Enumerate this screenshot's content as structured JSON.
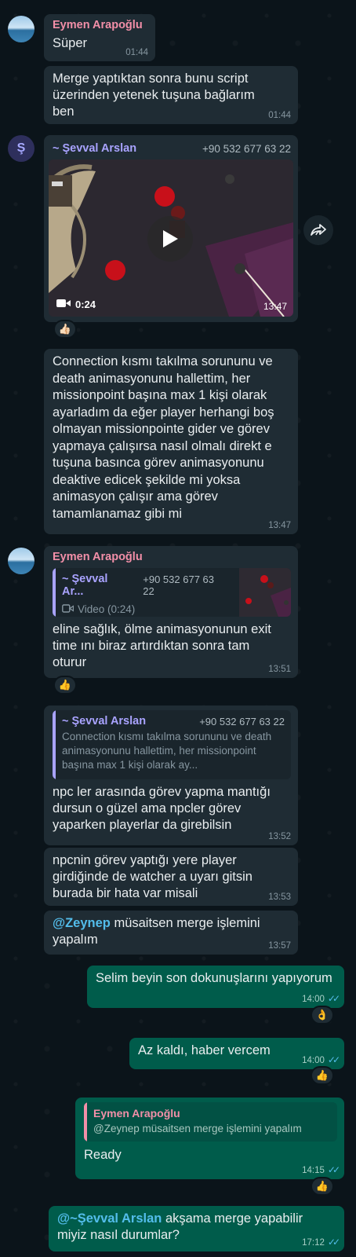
{
  "messages": {
    "m1": {
      "sender": "Eymen Arapoğlu",
      "text": "Süper",
      "time": "01:44"
    },
    "m2": {
      "text": "Merge yaptıktan sonra bunu script üzerinden yetenek tuşuna bağlarım ben",
      "time": "01:44"
    },
    "m3": {
      "avatar_letter": "Ş",
      "sender": "~ Şevval Arslan",
      "phone": "+90 532 677 63 22",
      "video_duration": "0:24",
      "time": "13:47",
      "reaction": "👍🏻"
    },
    "m4": {
      "text": "Connection kısmı takılma sorununu ve death animasyonunu hallettim, her missionpoint başına max 1 kişi olarak ayarladım da eğer player herhangi boş olmayan missionpointe gider ve görev yapmaya çalışırsa nasıl olmalı direkt e tuşuna basınca görev animasyonunu deaktive edicek şekilde mi yoksa animasyon çalışır ama görev tamamlanamaz gibi mi",
      "time": "13:47"
    },
    "m5": {
      "sender": "Eymen Arapoğlu",
      "quote_sender": "~ Şevval Ar...",
      "quote_phone": "+90 532 677 63 22",
      "quote_text": "Video (0:24)",
      "text": "eline sağlık, ölme animasyonunun exit time ını biraz artırdıktan sonra tam oturur",
      "time": "13:51",
      "reaction": "👍"
    },
    "m6": {
      "quote_sender": "~ Şevval Arslan",
      "quote_phone": "+90 532 677 63 22",
      "quote_text": "Connection kısmı takılma sorununu ve death animasyonunu hallettim, her missionpoint başına max 1 kişi olarak ay...",
      "text": "npc ler arasında görev yapma mantığı dursun o güzel ama npcler görev yaparken playerlar da girebilsin",
      "time": "13:52"
    },
    "m7": {
      "text": "npcnin görev yaptığı yere player girdiğinde de watcher a uyarı gitsin burada bir hata var misali",
      "time": "13:53"
    },
    "m8": {
      "mention": "@Zeynep",
      "text": " müsaitsen merge işlemini yapalım",
      "time": "13:57"
    },
    "m9": {
      "text": "Selim beyin son dokunuşlarını yapıyorum",
      "time": "14:00",
      "reaction": "👌"
    },
    "m10": {
      "text": "Az kaldı, haber vercem",
      "time": "14:00",
      "reaction": "👍"
    },
    "m11": {
      "quote_sender": "Eymen Arapoğlu",
      "quote_text": "@Zeynep müsaitsen merge işlemini yapalım",
      "text": "Ready",
      "time": "14:15",
      "reaction": "👍"
    },
    "m12": {
      "mention": "@~Şevval Arslan",
      "text": " akşama merge yapabilir miyiz nasıl durumlar?",
      "time": "17:12"
    }
  },
  "icons": {
    "forward": "forward-icon",
    "play": "play-icon",
    "video_camera": "video-camera-icon",
    "read_ticks": "double-check-icon"
  },
  "colors": {
    "background": "#0b141a",
    "incoming_bubble": "#1f2c34",
    "outgoing_bubble": "#005c4b",
    "eymen_name": "#f28fa8",
    "sevval_name": "#a9a3ff",
    "read_ticks": "#53bdeb"
  }
}
